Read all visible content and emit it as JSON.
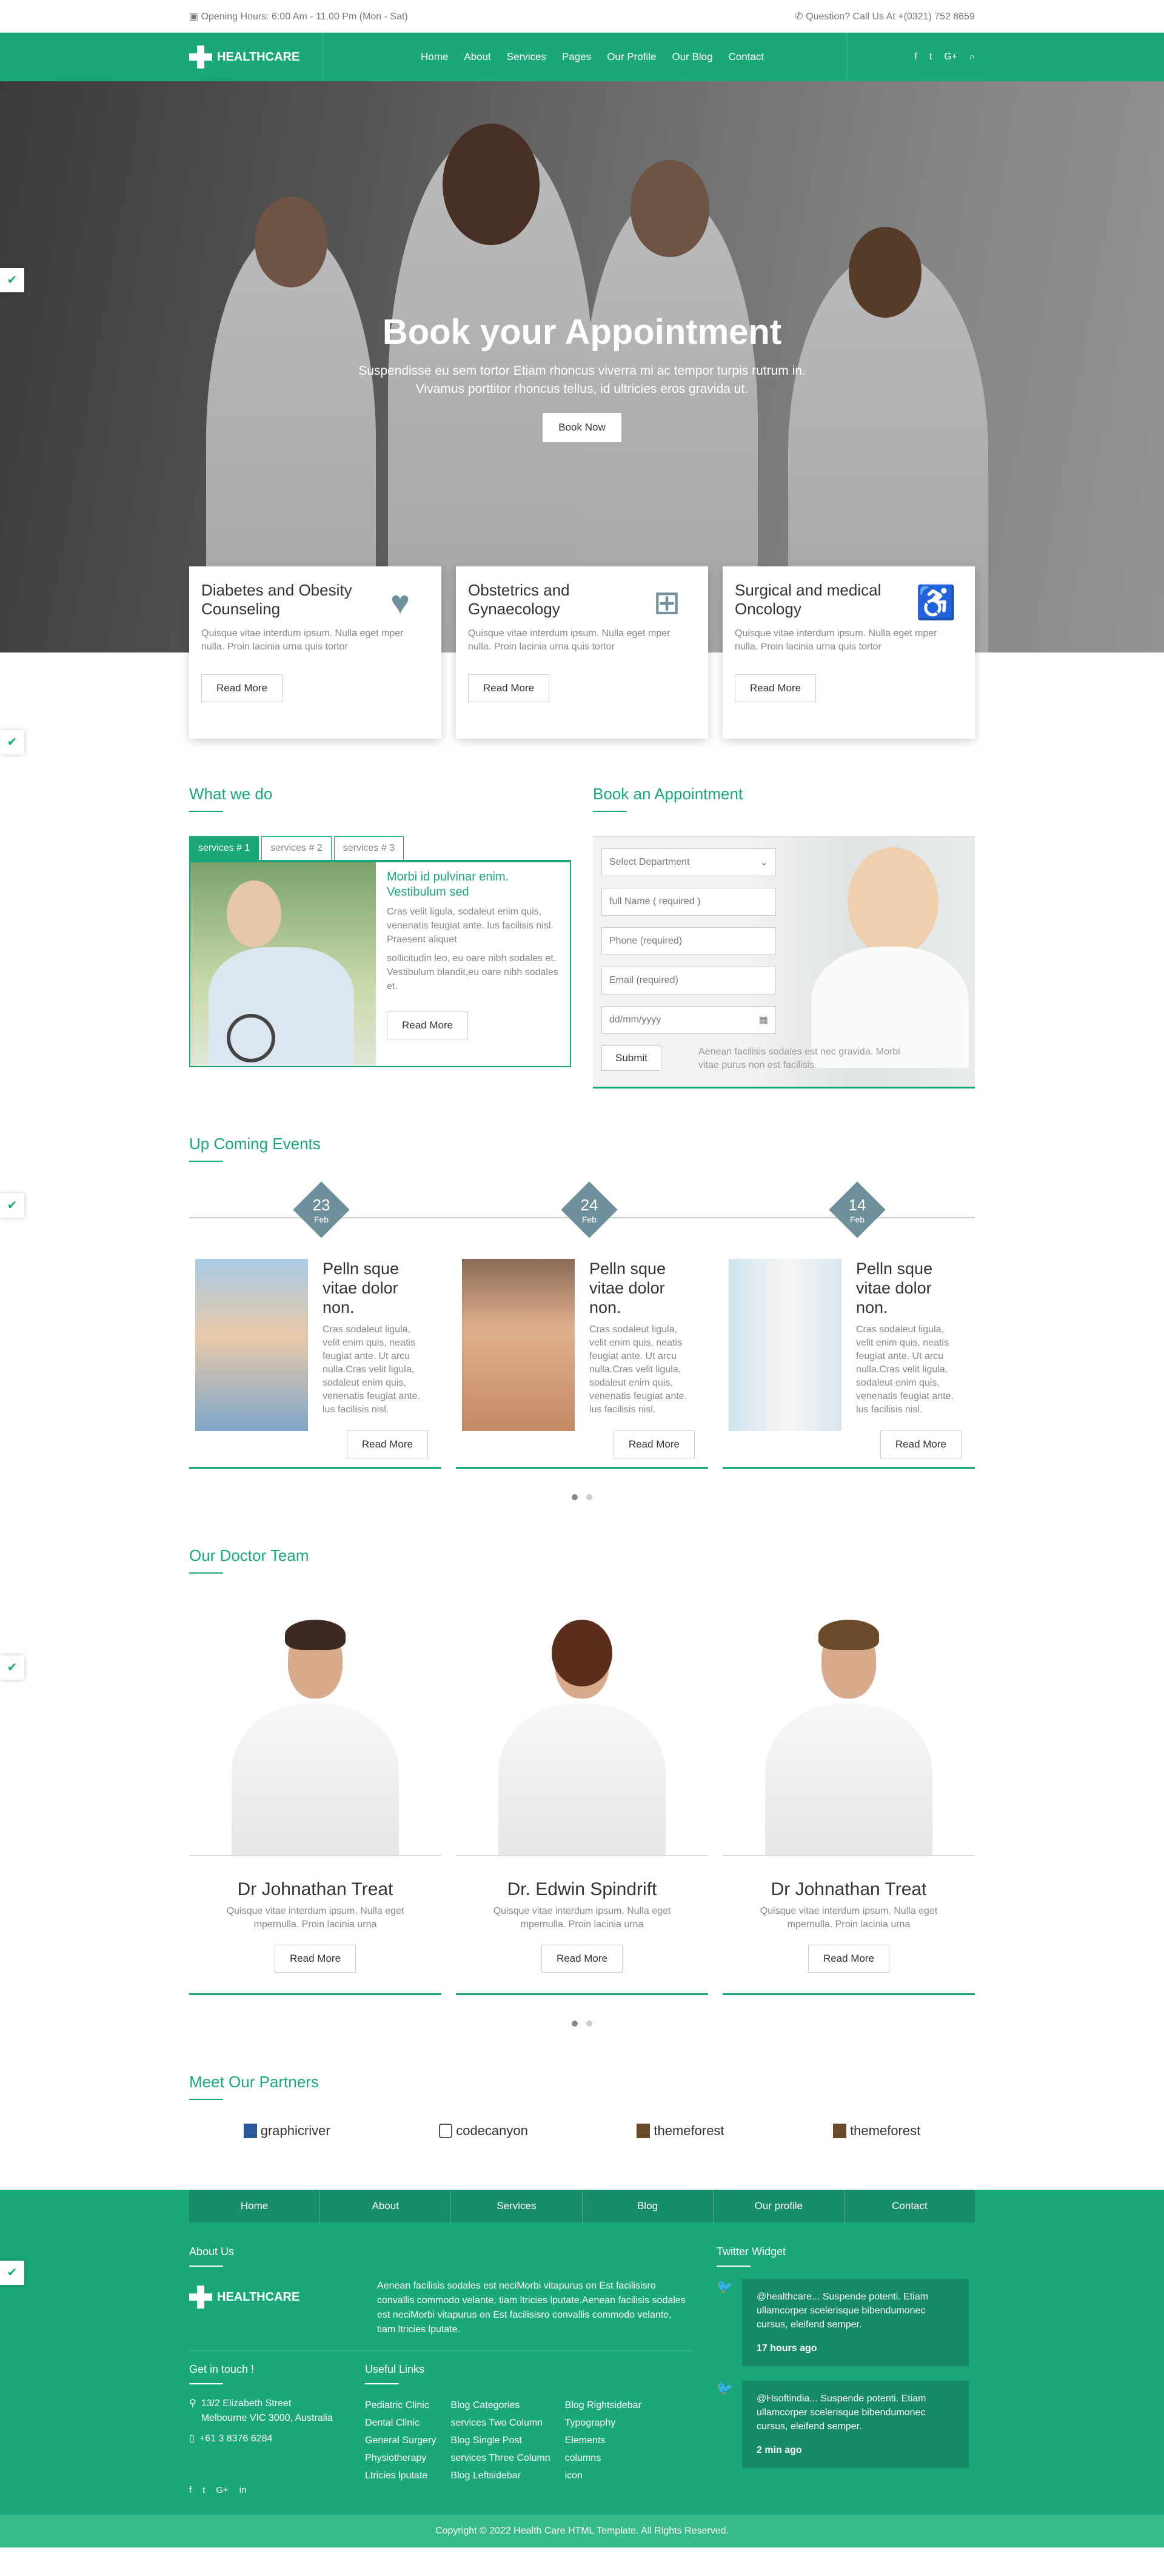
{
  "topbar": {
    "hours": "Opening Hours: 6:00 Am - 11.00 Pm (Mon - Sat)",
    "question": "Question? Call Us At +(0321) 752 8659"
  },
  "nav": {
    "logo": "HEALTHCARE",
    "items": [
      "Home",
      "About",
      "Services",
      "Pages",
      "Our Profile",
      "Our Blog",
      "Contact"
    ],
    "social": [
      "f",
      "t",
      "G+",
      "search"
    ]
  },
  "hero": {
    "title": "Book your Appointment",
    "text": "Suspendisse eu sem tortor Etiam rhoncus viverra mi ac tempor turpis rutrum in. Vivamus porttitor rhoncus tellus, id ultricies eros gravida ut.",
    "button": "Book Now"
  },
  "services": [
    {
      "title": "Diabetes and Obesity Counseling",
      "text": "Quisque vitae interdum ipsum. Nulla eget mper nulla. Proin lacinia urna quis tortor",
      "button": "Read More",
      "icon": "heart-pulse-icon"
    },
    {
      "title": "Obstetrics and Gynaecology",
      "text": "Quisque vitae interdum ipsum. Nulla eget mper nulla. Proin lacinia urna quis tortor",
      "button": "Read More",
      "icon": "medkit-icon"
    },
    {
      "title": "Surgical and medical Oncology",
      "text": "Quisque vitae interdum ipsum. Nulla eget mper nulla. Proin lacinia urna quis tortor",
      "button": "Read More",
      "icon": "wheelchair-icon"
    }
  ],
  "whatwedo": {
    "title": "What we do",
    "tabs": [
      "services # 1",
      "services # 2",
      "services # 3"
    ],
    "heading": "Morbi id pulvinar enim. Vestibulum sed",
    "p1": "Cras velit ligula, sodaleut enim quis, venenatis feugiat ante. lus facilisis nisl. Praesent aliquet",
    "p2": "sollicitudin leo, eu oare nibh sodales et. Vestibulum blandit,eu oare nibh sodales et.",
    "button": "Read More"
  },
  "appointment": {
    "title": "Book an Appointment",
    "department": "Select Department",
    "name": "full Name ( required )",
    "phone": "Phone (required)",
    "email": "Email (required)",
    "date": "dd/mm/yyyy",
    "submit": "Submit",
    "note": "Aenean facilisis sodales est nec gravida. Morbi vitae purus non est facilisis."
  },
  "events": {
    "title": "Up Coming Events",
    "dates": [
      {
        "day": "23",
        "month": "Feb"
      },
      {
        "day": "24",
        "month": "Feb"
      },
      {
        "day": "14",
        "month": "Feb"
      }
    ],
    "items": [
      {
        "title": "Pelln sque vitae dolor non.",
        "text": "Cras sodaleut ligula, velit enim quis, neatis feugiat ante. Ut arcu nulla.Cras velit ligula, sodaleut enim quis, venenatis feugiat ante. lus facilisis nisl.",
        "button": "Read More"
      },
      {
        "title": "Pelln sque vitae dolor non.",
        "text": "Cras sodaleut ligula, velit enim quis, neatis feugiat ante. Ut arcu nulla.Cras velit ligula, sodaleut enim quis, venenatis feugiat ante. lus facilisis nisl.",
        "button": "Read More"
      },
      {
        "title": "Pelln sque vitae dolor non.",
        "text": "Cras sodaleut ligula, velit enim quis, neatis feugiat ante. Ut arcu nulla.Cras velit ligula, sodaleut enim quis, venenatis feugiat ante. lus facilisis nisl.",
        "button": "Read More"
      }
    ]
  },
  "doctors": {
    "title": "Our Doctor Team",
    "items": [
      {
        "name": "Dr Johnathan Treat",
        "text": "Quisque vitae interdum ipsum. Nulla eget mpernulla. Proin lacinia urna",
        "button": "Read More"
      },
      {
        "name": "Dr. Edwin Spindrift",
        "text": "Quisque vitae interdum ipsum. Nulla eget mpernulla. Proin lacinia urna",
        "button": "Read More"
      },
      {
        "name": "Dr Johnathan Treat",
        "text": "Quisque vitae interdum ipsum. Nulla eget mpernulla. Proin lacinia urna",
        "button": "Read More"
      }
    ]
  },
  "partners": {
    "title": "Meet Our Partners",
    "items": [
      "graphicriver",
      "codecanyon",
      "themeforest",
      "themeforest"
    ]
  },
  "footer": {
    "menu": [
      "Home",
      "About",
      "Services",
      "Blog",
      "Our profile",
      "Contact"
    ],
    "about_title": "About Us",
    "logo": "HEALTHCARE",
    "about_text": "Aenean facilisis sodales est neciMorbi vitapurus on Est facilisisro convallis commodo velante, tiam ltricies lputate.Aenean facilisis sodales est neciMorbi vitapurus on Est facilisisro convallis commodo velante, tiam ltricies lputate.",
    "touch_title": "Get in touch !",
    "address": "13/2 Elizabeth Street Melbourne VIC 3000, Australia",
    "phone": "+61 3 8376 6284",
    "social": [
      "f",
      "t",
      "G+",
      "in"
    ],
    "links_title": "Useful Links",
    "links1": [
      "Pediatric Clinic",
      "Dental Clinic",
      "General Surgery",
      "Physiotherapy",
      "Ltricies lputate"
    ],
    "links2": [
      "Blog Categories",
      "services Two Column",
      "Blog Single Post",
      "services Three Column",
      "Blog Leftsidebar"
    ],
    "links3": [
      "Blog Rightsidebar",
      "Typography",
      "Elements",
      "columns",
      "icon"
    ],
    "twitter_title": "Twitter Widget",
    "tweets": [
      {
        "text": "@healthcare... Suspende potenti. Etiam ullamcorper scelerisque bibendumonec cursus, eleifend semper.",
        "time": "17 hours ago"
      },
      {
        "text": "@Hsoftindia... Suspende potenti. Etiam ullamcorper scelerisque bibendumonec cursus, eleifend semper.",
        "time": "2 min ago"
      }
    ],
    "copyright": "Copyright © 2022 Health Care HTML Template. All Rights Reserved."
  },
  "colors": {
    "accent": "#1aa77a",
    "icon_gray": "#6f8f9b"
  }
}
